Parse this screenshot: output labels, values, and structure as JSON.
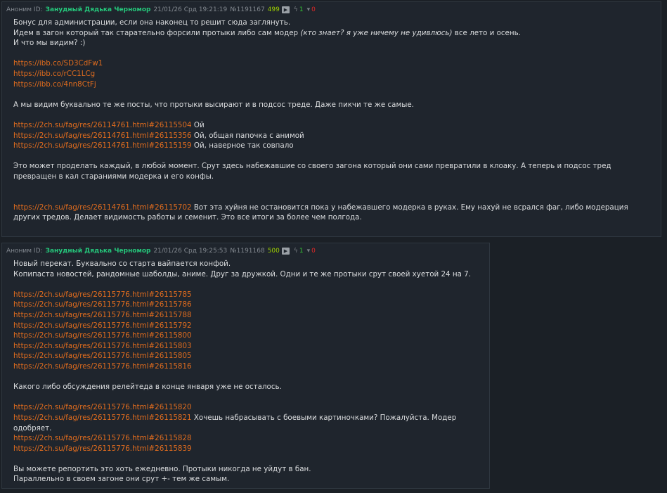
{
  "posts": [
    {
      "author_prefix": "Аноним ID:",
      "author_name": "Занудный Дядька Черномор",
      "datetime": "21/01/26 Срд 19:21:19",
      "number": "№1191167",
      "reply_count": "499",
      "play_icon": "play-icon",
      "likes": "1",
      "dislikes": "0",
      "lines": [
        {
          "t": "Бонус для администрации, если она наконец то решит сюда заглянуть."
        },
        {
          "t": "Идем в загон который так старательно форсили протыки либо сам модер ",
          "em": "(кто знает? я уже ничему не удивлюсь)",
          "after": " все лето и осень."
        },
        {
          "t": "И что мы видим? :)"
        },
        {
          "blank": true
        },
        {
          "link": "https://ibb.co/SD3CdFw1"
        },
        {
          "link": "https://ibb.co/rCC1LCg"
        },
        {
          "link": "https://ibb.co/4nn8CtFj"
        },
        {
          "blank": true
        },
        {
          "t": "А мы видим буквально те же посты, что протыки высирают и в подсос треде. Даже пикчи те же самые."
        },
        {
          "blank": true
        },
        {
          "link": "https://2ch.su/fag/res/26114761.html#26115504",
          "after": " Ой"
        },
        {
          "link": "https://2ch.su/fag/res/26114761.html#26115356",
          "after": " Ой, общая папочка с анимой"
        },
        {
          "link": "https://2ch.su/fag/res/26114761.html#26115159",
          "after": " Ой, наверное так совпало"
        },
        {
          "blank": true
        },
        {
          "t": "Это может проделать каждый, в любой момент. Срут здесь набежавшие со своего загона который они сами превратили в клоаку. А теперь и подсос тред превращен в кал стараниями модерка и его конфы."
        },
        {
          "blank": true
        },
        {
          "blank": true
        },
        {
          "link": "https://2ch.su/fag/res/26114761.html#26115702",
          "after": " Вот эта хуйня не остановится пока у набежавшего модерка в руках. Ему нахуй не всрался фаг, либо модерация других тредов. Делает видимость работы и семенит. Это все итоги за более чем полгода."
        }
      ]
    },
    {
      "author_prefix": "Аноним ID:",
      "author_name": "Занудный Дядька Черномор",
      "datetime": "21/01/26 Срд 19:25:53",
      "number": "№1191168",
      "reply_count": "500",
      "play_icon": "play-icon",
      "likes": "1",
      "dislikes": "0",
      "lines": [
        {
          "t": "Новый перекат. Буквально со старта вайпается конфой."
        },
        {
          "t": "Копипаста новостей, рандомные шаболды, аниме. Друг за дружкой. Одни и те же протыки срут своей хуетой 24 на 7."
        },
        {
          "blank": true
        },
        {
          "link": "https://2ch.su/fag/res/26115776.html#26115785"
        },
        {
          "link": "https://2ch.su/fag/res/26115776.html#26115786"
        },
        {
          "link": "https://2ch.su/fag/res/26115776.html#26115788"
        },
        {
          "link": "https://2ch.su/fag/res/26115776.html#26115792"
        },
        {
          "link": "https://2ch.su/fag/res/26115776.html#26115800"
        },
        {
          "link": "https://2ch.su/fag/res/26115776.html#26115803"
        },
        {
          "link": "https://2ch.su/fag/res/26115776.html#26115805"
        },
        {
          "link": "https://2ch.su/fag/res/26115776.html#26115816"
        },
        {
          "blank": true
        },
        {
          "t": "Какого либо обсуждения релейтеда в конце января уже не осталось."
        },
        {
          "blank": true
        },
        {
          "link": "https://2ch.su/fag/res/26115776.html#26115820"
        },
        {
          "link": "https://2ch.su/fag/res/26115776.html#26115821",
          "after": " Хочешь набрасывать с боевыми картиночками? Пожалуйста. Модер одобряет."
        },
        {
          "link": "https://2ch.su/fag/res/26115776.html#26115828"
        },
        {
          "link": "https://2ch.su/fag/res/26115776.html#26115839"
        },
        {
          "blank": true
        },
        {
          "t": "Вы можете репортить это хоть ежедневно. Протыки никогда не уйдут в бан."
        },
        {
          "t": "Параллельно в своем загоне они срут +- тем же самым."
        }
      ]
    }
  ]
}
